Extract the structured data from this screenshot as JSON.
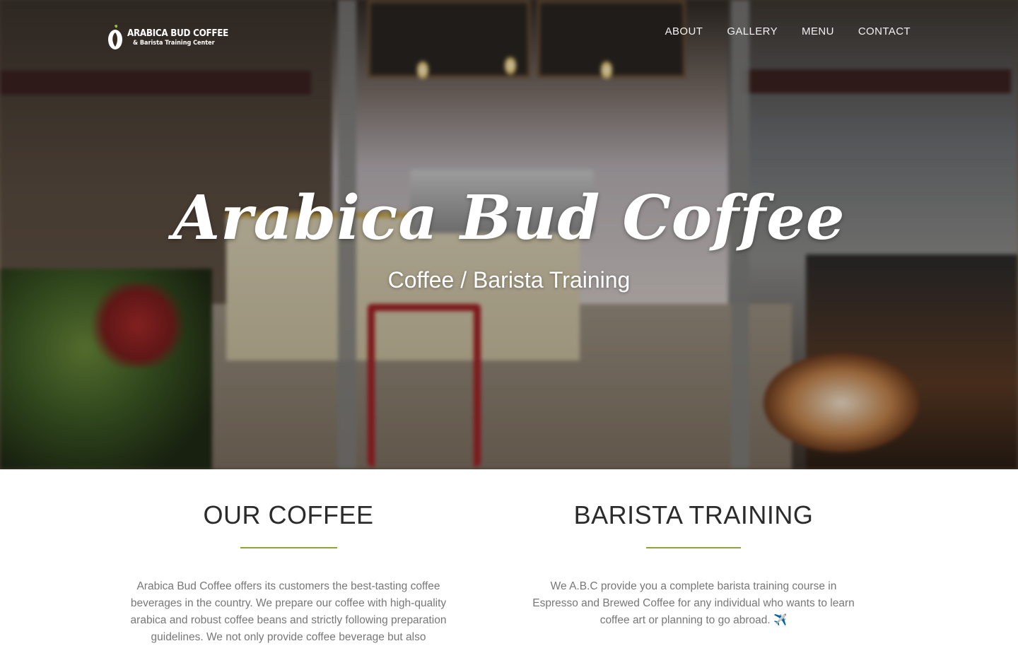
{
  "brand": {
    "logo_line1": "ARABICA BUD COFFEE",
    "logo_line2": "& Barista Training Center"
  },
  "nav": {
    "items": [
      {
        "label": "ABOUT"
      },
      {
        "label": "GALLERY"
      },
      {
        "label": "MENU"
      },
      {
        "label": "CONTACT"
      }
    ]
  },
  "hero": {
    "title": "Arabica Bud Coffee",
    "subtitle": "Coffee / Barista Training"
  },
  "sections": {
    "coffee": {
      "heading": "OUR COFFEE",
      "body": "Arabica Bud Coffee offers its customers the best-tasting coffee beverages in the country. We prepare our coffee with high-quality arabica and robust coffee beans and strictly following preparation guidelines. We not only provide coffee beverage but also"
    },
    "training": {
      "heading": "BARISTA TRAINING",
      "body": "We A.B.C provide you a complete barista training course in Espresso and Brewed Coffee for any individual who wants to learn coffee art or planning to go abroad. ✈️"
    }
  },
  "colors": {
    "accent": "#8fa23a",
    "heading": "#2b2b2b",
    "body_text": "#777777"
  }
}
